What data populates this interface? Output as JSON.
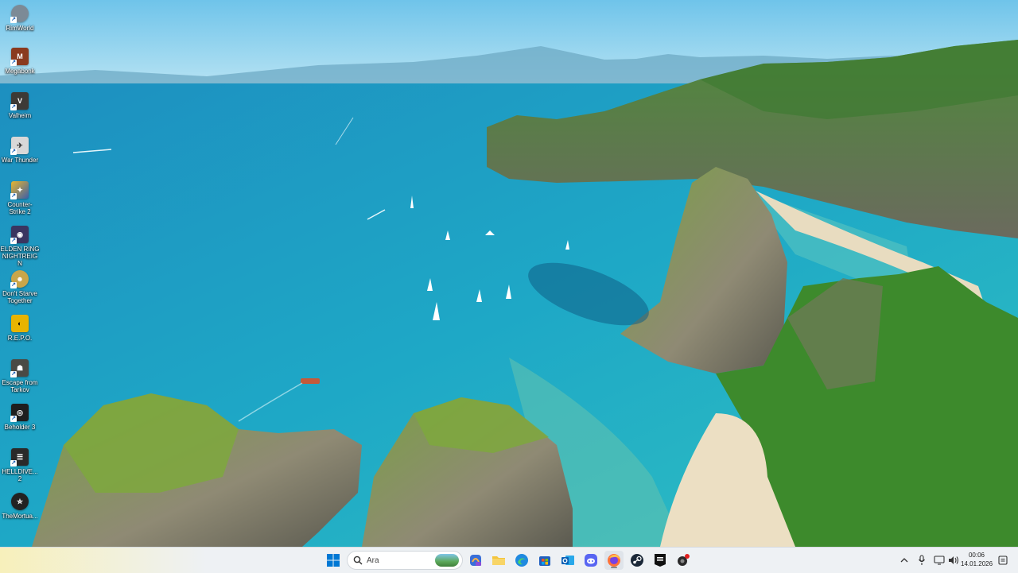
{
  "desktop": {
    "icons": [
      {
        "label": "RimWorld",
        "icon": "rimworld-icon",
        "color": "#7c8a96"
      },
      {
        "label": "Megabonk",
        "icon": "megabonk-icon",
        "color": "#8a3a1f"
      },
      {
        "label": "Valheim",
        "icon": "valheim-icon",
        "color": "#3d3a36"
      },
      {
        "label": "War Thunder",
        "icon": "war-thunder-icon",
        "color": "#d8d8d8"
      },
      {
        "label": "Counter-Strike 2",
        "icon": "counter-strike-icon",
        "color": "#e8b530"
      },
      {
        "label": "ELDEN RING NIGHTREIGN",
        "icon": "elden-ring-icon",
        "color": "#3a3560"
      },
      {
        "label": "Don't Starve Together",
        "icon": "dont-starve-icon",
        "color": "#c9a64a"
      },
      {
        "label": "R.E.P.O.",
        "icon": "repo-icon",
        "color": "#1c1c1c"
      },
      {
        "label": "Escape from Tarkov",
        "icon": "tarkov-icon",
        "color": "#4a4a44"
      },
      {
        "label": "Beholder 3",
        "icon": "beholder-icon",
        "color": "#1e1e1e"
      },
      {
        "label": "HELLDIVE... 2",
        "icon": "helldivers-icon",
        "color": "#2a2a2a"
      },
      {
        "label": "TheMortua...",
        "icon": "mortuary-icon",
        "color": "#222222"
      }
    ]
  },
  "taskbar": {
    "search_placeholder": "Ara",
    "apps": [
      {
        "name": "start-button",
        "icon": "windows-icon"
      },
      {
        "name": "copilot-app",
        "icon": "copilot-icon"
      },
      {
        "name": "file-explorer",
        "icon": "folder-icon"
      },
      {
        "name": "edge-browser",
        "icon": "edge-icon"
      },
      {
        "name": "microsoft-store",
        "icon": "store-icon"
      },
      {
        "name": "outlook",
        "icon": "outlook-icon"
      },
      {
        "name": "discord",
        "icon": "discord-icon"
      },
      {
        "name": "firefox",
        "icon": "firefox-icon"
      },
      {
        "name": "steam",
        "icon": "steam-icon"
      },
      {
        "name": "epic-games",
        "icon": "epic-games-icon"
      },
      {
        "name": "app-with-badge",
        "icon": "app-icon"
      }
    ],
    "tray": {
      "time": "00:06",
      "date": "14.01.2026"
    }
  },
  "colors": {
    "sea": "#1fa3c4",
    "taskbar": "#eef1f4",
    "accent": "#0067c0"
  }
}
